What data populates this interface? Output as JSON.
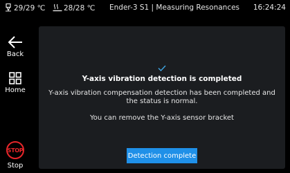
{
  "status_bar": {
    "nozzle_temp": "29/29 ℃",
    "bed_temp": "28/28 ℃",
    "title": "Ender-3 S1 | Measuring Resonances",
    "time": "16:24:24"
  },
  "sidebar": {
    "back_label": "Back",
    "home_label": "Home",
    "stop_icon_text": "STOP",
    "stop_label": "Stop"
  },
  "dialog": {
    "title": "Y-axis vibration detection is completed",
    "description": "Y-axis vibration compensation detection has been completed and the status is normal.",
    "note": "You can remove the Y-axis sensor bracket",
    "button_label": "Detection complete"
  },
  "colors": {
    "accent": "#1f90e8",
    "success_check": "#3fa7e6",
    "stop_red": "#e8262a",
    "panel_bg": "#1b1d20"
  }
}
